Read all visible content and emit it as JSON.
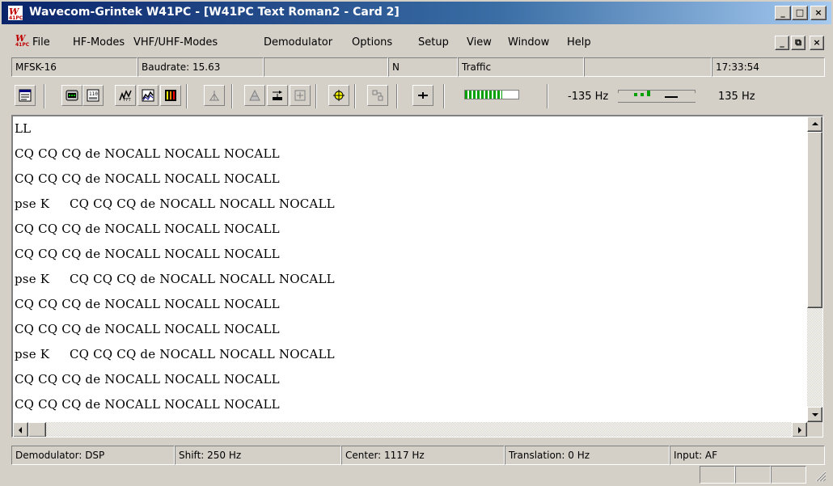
{
  "window": {
    "title": "Wavecom-Grintek W41PC - [W41PC Text Roman2 - Card 2]",
    "minimize_glyph": "_",
    "maximize_glyph": "□",
    "close_glyph": "×"
  },
  "menu": {
    "items": [
      "File",
      "HF-Modes",
      "VHF/UHF-Modes",
      "Demodulator",
      "Options",
      "Setup",
      "View",
      "Window",
      "Help"
    ],
    "mdi_min_glyph": "_",
    "mdi_restore_glyph": "⧉",
    "mdi_close_glyph": "×"
  },
  "status_top": {
    "mode": "MFSK-16",
    "baudrate": "Baudrate: 15.63",
    "field3": "",
    "polarity": "N",
    "traffic": "Traffic",
    "field6": "",
    "time": "17:33:54"
  },
  "toolbar": {
    "icons": [
      "screen-icon",
      "modem-icon",
      "keyboard-icon",
      "fft-icon",
      "waterfall-icon",
      "bars-icon",
      "antenna-icon",
      "analyzer-icon",
      "tuning-icon",
      "frame-icon",
      "target-icon",
      "network-icon",
      "plus-minus-icon"
    ],
    "level_fill": 0.7,
    "freq_left": "-135 Hz",
    "freq_right": "135 Hz"
  },
  "text_lines": [
    "LL",
    "CQ CQ CQ de NOCALL NOCALL NOCALL",
    "CQ CQ CQ de NOCALL NOCALL NOCALL",
    "pse K     CQ CQ CQ de NOCALL NOCALL NOCALL",
    "CQ CQ CQ de NOCALL NOCALL NOCALL",
    "CQ CQ CQ de NOCALL NOCALL NOCALL",
    "pse K     CQ CQ CQ de NOCALL NOCALL NOCALL",
    "CQ CQ CQ de NOCALL NOCALL NOCALL",
    "CQ CQ CQ de NOCALL NOCALL NOCALL",
    "pse K     CQ CQ CQ de NOCALL NOCALL NOCALL",
    "CQ CQ CQ de NOCALL NOCALL NOCALL",
    "CQ CQ CQ de NOCALL NOCALL NOCALL"
  ],
  "status_bottom": {
    "demodulator": "Demodulator: DSP",
    "shift": "Shift: 250 Hz",
    "center": "Center: 1117 Hz",
    "translation": "Translation: 0 Hz",
    "input": "Input: AF"
  },
  "colors": {
    "title_start": "#0a246a",
    "title_end": "#a6caf0",
    "level_green": "#00a000",
    "face": "#d4d0c8"
  }
}
